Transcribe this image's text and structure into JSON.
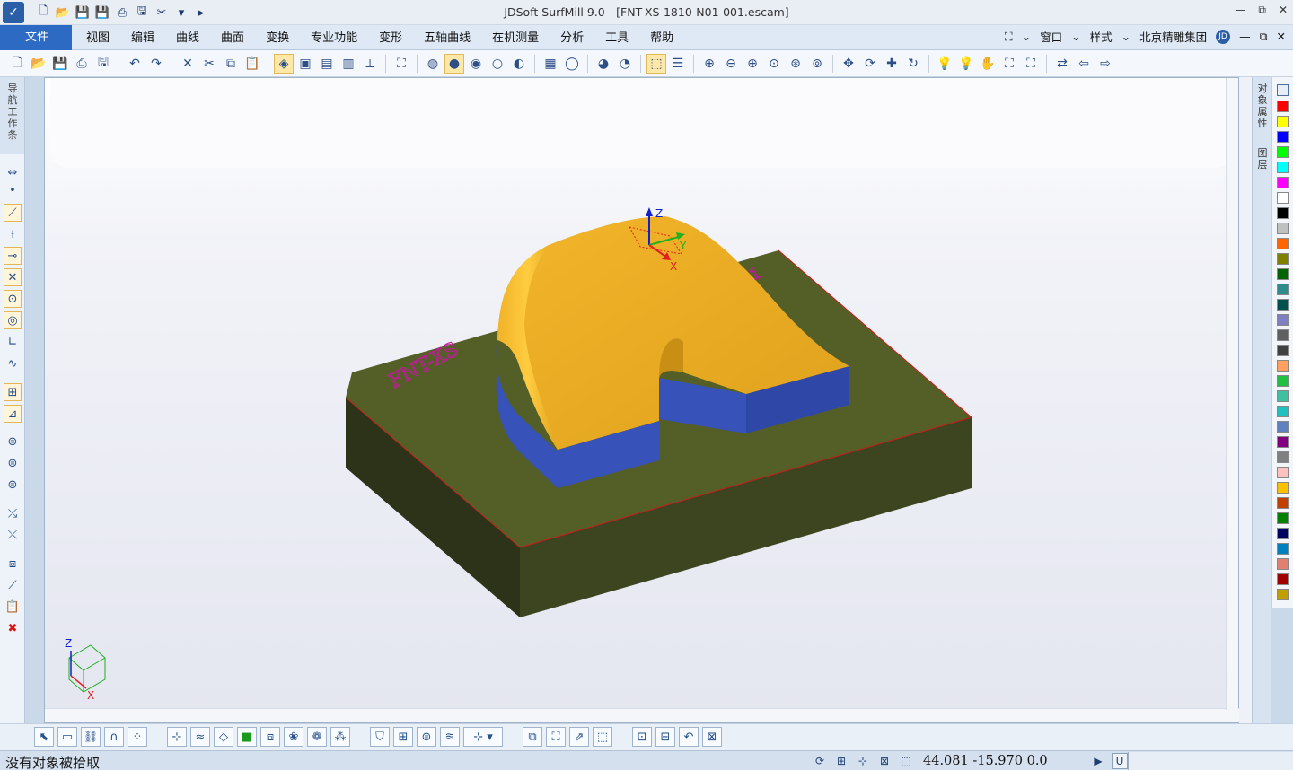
{
  "titlebar": {
    "title": "JDSoft SurfMill 9.0 - [FNT-XS-1810-N01-001.escam]",
    "logo_icon": "surfmill-logo-icon",
    "minimize": "—",
    "restore": "⧉",
    "close": "✕"
  },
  "menubar": {
    "file": "文件",
    "items": [
      "视图",
      "编辑",
      "曲线",
      "曲面",
      "变换",
      "专业功能",
      "变形",
      "五轴曲线",
      "在机测量",
      "分析",
      "工具",
      "帮助"
    ],
    "window": "窗口",
    "style": "样式",
    "company": "北京精雕集团",
    "jd_badge": "JD"
  },
  "nav_panel": {
    "label": "导航工作条"
  },
  "right_panel": {
    "object_props": "对象属性",
    "layers": "图层"
  },
  "viewport": {
    "engraved_text": "FNT-XS",
    "engraved_text_right": "1",
    "axis_x": "X",
    "axis_y": "Y",
    "axis_z": "Z",
    "triad_z": "Z",
    "triad_x": "X",
    "colors": {
      "top_face": "#e8a71e",
      "side_face": "#3752b8",
      "base_top": "#545f28",
      "base_front": "#3c4420",
      "base_side": "#2c3318"
    }
  },
  "palette": [
    "#ff0000",
    "#ffff00",
    "#0000ff",
    "#00ff00",
    "#00ffff",
    "#ff00ff",
    "#ffffff",
    "#000000",
    "#c0c0c0",
    "#ff6600",
    "#808000",
    "#006400",
    "#2e8b8b",
    "#005050",
    "#8080c0",
    "#606060",
    "#404040",
    "#ffa060",
    "#20c040",
    "#40c0a0",
    "#20c0c0",
    "#6080c0",
    "#800080",
    "#808080",
    "#ffc0c0",
    "#ffc000",
    "#c04000",
    "#008000",
    "#000060",
    "#0080c0",
    "#e08070",
    "#a00000",
    "#c0a000"
  ],
  "status": {
    "message": "没有对象被拾取",
    "coords": "44.081  -15.970  0.0",
    "u_button": "U"
  }
}
